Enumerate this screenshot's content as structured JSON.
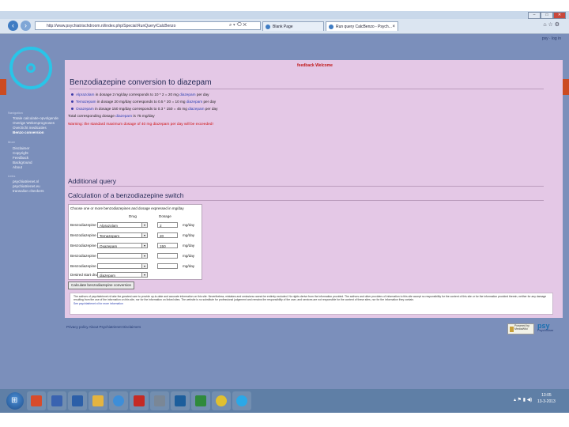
{
  "browser": {
    "url": "http://www.psychiatrischdroom.nl/index.php/Special:RunQuery/CalcBenzo",
    "tabs": [
      {
        "label": "Blank Page"
      },
      {
        "label": "Run query CalcBenzo - Psych..."
      }
    ],
    "window_controls": {
      "minimize": "–",
      "maximize": "□",
      "close": "✕"
    },
    "top_links": "psy · log in"
  },
  "sidebar": {
    "sections": [
      {
        "title": "Navigation",
        "items": [
          "Totale calculatie-opvolgende",
          "Overige Wekenprognoses",
          "Overzicht medicaties",
          "Benzo conversion"
        ]
      },
      {
        "title": "More",
        "items": [
          "Disclaimer",
          "Copyright",
          "Feedback",
          "Background",
          "About"
        ]
      },
      {
        "title": "Links",
        "items": [
          "psychiatrienet.nl",
          "psychiatrienet.eu",
          "transalion checkers"
        ]
      }
    ],
    "active_item": "Benzo conversion"
  },
  "content": {
    "feedback": "feedback Welcome",
    "title": "Benzodiazepine conversion to diazepam",
    "bullets": [
      {
        "drug": "Alprazolam",
        "text": " in dosage 2 mg/day corresponds to 10 * 2 = 20 mg ",
        "target": "diazepam",
        "tail": " per day"
      },
      {
        "drug": "Temazepam",
        "text": " in dosage 20 mg/day corresponds to 0.5 * 20 = 10 mg ",
        "target": "diazepam",
        "tail": " per day"
      },
      {
        "drug": "Oxazepam",
        "text": " in dosage 150 mg/day corresponds to 0.3 * 150 = 45 mg ",
        "target": "diazepam",
        "tail": " per day"
      }
    ],
    "total_pre": "Total corresponding dosage ",
    "total_drug": "diazepam",
    "total_post": " is 75 mg/day",
    "warning": "Warning: the standard maximum dosage of 40 mg diazepam per day will be exceeded!",
    "additional": "Additional query",
    "switch_title": "Calculation of a benzodiazepine switch",
    "form": {
      "caption": "Choose one or more benzodiazepines and dosage expressed in mg/day",
      "col_drug": "Drug",
      "col_dosage": "Dosage",
      "rows": [
        {
          "label": "Benzodiazepine 1",
          "drug": "Alprazolam",
          "dose": "2",
          "unit": "mg/day"
        },
        {
          "label": "Benzodiazepine 2",
          "drug": "Temazepam",
          "dose": "20",
          "unit": "mg/day"
        },
        {
          "label": "Benzodiazepine 3",
          "drug": "Oxazepam",
          "dose": "150",
          "unit": "mg/day"
        },
        {
          "label": "Benzodiazepine 4",
          "drug": "",
          "dose": "",
          "unit": "mg/day"
        },
        {
          "label": "Benzodiazepine 5",
          "drug": "",
          "dose": "",
          "unit": "mg/day"
        }
      ],
      "desired_label": "Desired start drug",
      "desired_value": "diazepam",
      "button": "Calculate benzodiazepine conversion"
    },
    "disclaimer": "The authors of psychiatrienet.nl take the greatest care to provide up-to-date and accurate information on this site. Nevertheless, mistakes and omissions cannot be entirely excluded. No rights derive from the information provided. The authors and other providers of information to this site accept no responsibility for the content of this site or for the information provided therein, neither for any damage resulting from the use of the information on this site, nor for the information on linked sites. The website is no substitute for professional judgement and remains the responsibility of the user, and services are not responsible for the content of these sites, nor for the information they contain.",
    "disclaimer_link": "See psychiatrienet.nl for more information"
  },
  "footer": {
    "links": "Privacy policy   About Psychiatrienet   Disclaimers",
    "badge_mw": "Powered by MediaWiki",
    "badge_brand": "psy",
    "badge_brand_sub": "PsychWare"
  },
  "taskbar": {
    "time": "13:05",
    "date": "13-3-2013",
    "apps": [
      "explorer-icon",
      "office-icon",
      "media-icon",
      "outlook-icon",
      "folder-icon",
      "ie-icon",
      "acrobat-icon",
      "tool-icon",
      "remote-icon",
      "excel-icon",
      "uknown-icon",
      "chrome-icon",
      "skype-icon"
    ]
  }
}
